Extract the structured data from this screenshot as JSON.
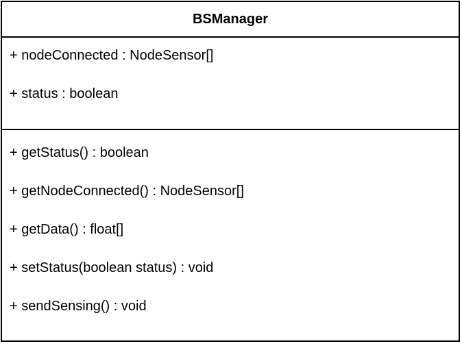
{
  "class": {
    "name": "BSManager",
    "attributes": [
      "+ nodeConnected : NodeSensor[]",
      "+ status : boolean"
    ],
    "operations": [
      "+ getStatus() : boolean",
      "+ getNodeConnected() : NodeSensor[]",
      "+ getData() : float[]",
      "+ setStatus(boolean status) : void",
      "+ sendSensing() : void"
    ]
  }
}
